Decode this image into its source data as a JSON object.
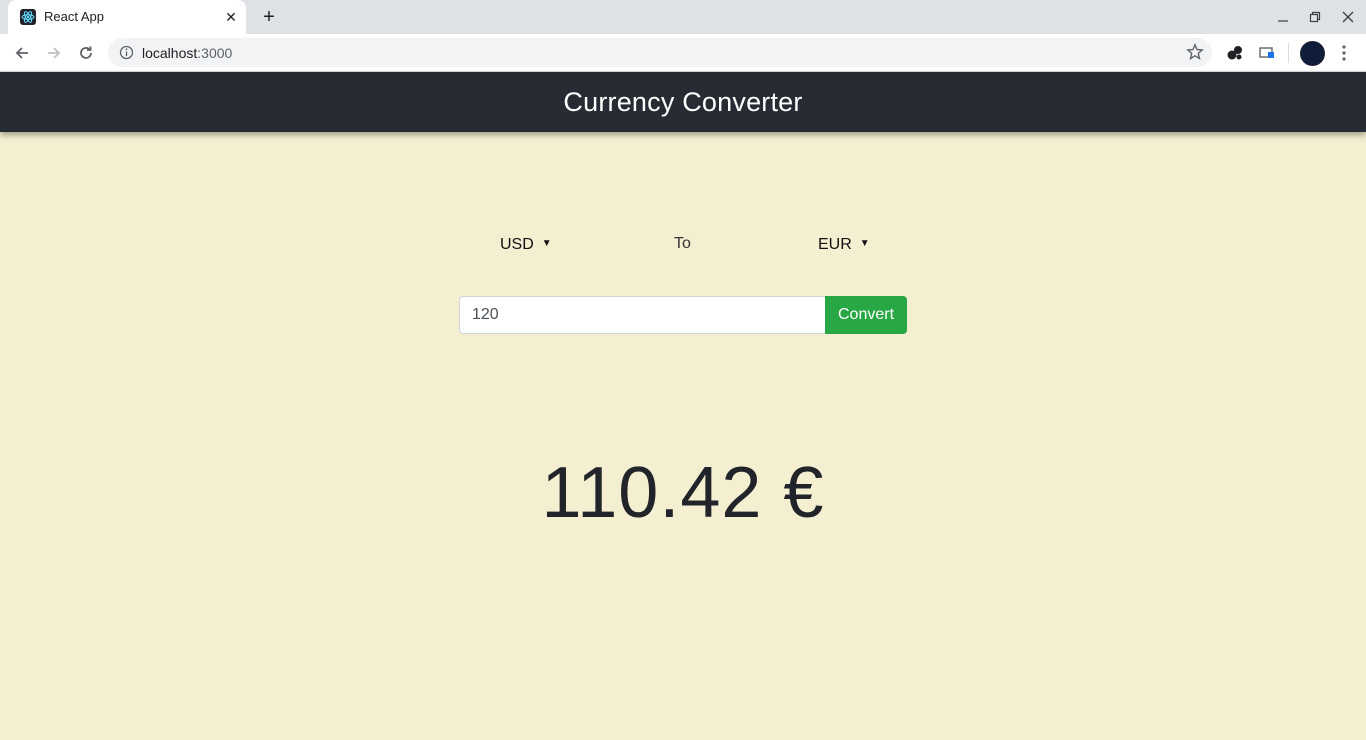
{
  "browser": {
    "tab_title": "React App",
    "url_host": "localhost",
    "url_port": ":3000",
    "close_tab_icon": "close-icon",
    "new_tab_symbol": "+"
  },
  "app": {
    "title": "Currency Converter",
    "from_currency": "USD",
    "to_label": "To",
    "to_currency": "EUR",
    "amount_value": "120",
    "convert_label": "Convert",
    "result": "110.42 €"
  },
  "colors": {
    "page_background": "#f5efd2",
    "header_background": "#272b33",
    "convert_button": "#28a745"
  }
}
